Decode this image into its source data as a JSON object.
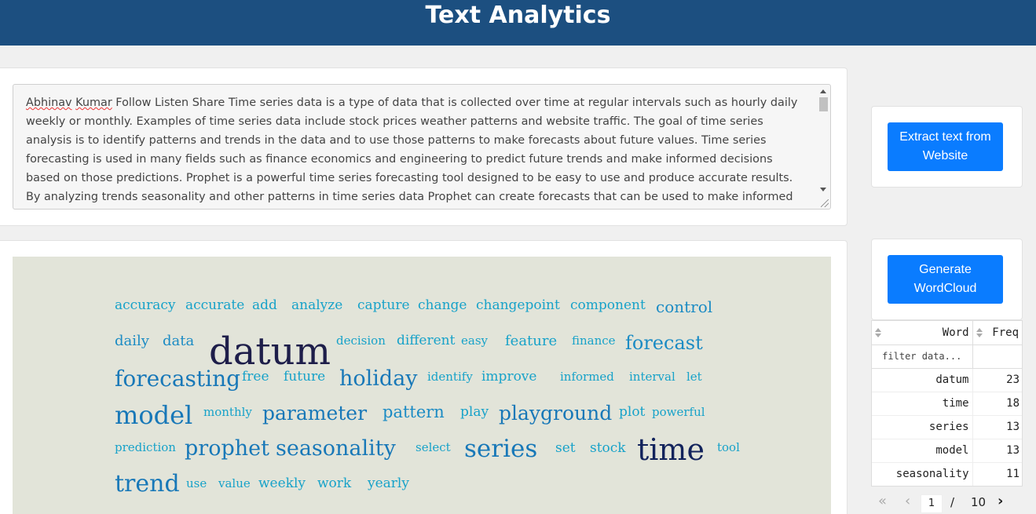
{
  "header": {
    "title": "Text Analytics"
  },
  "text_input": {
    "author_first": "Abhinav",
    "author_last": "Kumar",
    "value": " Follow    Listen Share Time series data is a type of data that is collected over time at regular intervals  such as hourly  daily  weekly  or monthly. Examples of time series data include stock prices  weather patterns  and website traffic. The goal of time series analysis is to identify patterns and trends in the data and to use those patterns to make forecasts about future values. Time series forecasting is used in many fields  such as finance  economics  and engineering  to predict future trends and make informed decisions based on those predictions. Prophet is a powerful time series forecasting tool designed to be easy to use and produce accurate results. By analyzing trends  seasonality  and other patterns in time series data  Prophet can create forecasts that can be used to make informed decisions and anticipate future"
  },
  "buttons": {
    "extract_label": "Extract text from Website",
    "wordcloud_label": "Generate WordCloud"
  },
  "wordcloud": {
    "background": "#e2e4d9",
    "words": [
      {
        "text": "accuracy",
        "color": "#17a2c9"
      },
      {
        "text": "accurate",
        "color": "#17a2c9"
      },
      {
        "text": "add",
        "color": "#17a2c9"
      },
      {
        "text": "analyze",
        "color": "#17a2c9"
      },
      {
        "text": "capture",
        "color": "#17a2c9"
      },
      {
        "text": "change",
        "color": "#17a2c9"
      },
      {
        "text": "changepoint",
        "color": "#17a2c9"
      },
      {
        "text": "component",
        "color": "#17a2c9"
      },
      {
        "text": "control",
        "color": "#1b8bc4"
      },
      {
        "text": "daily",
        "color": "#1b8bc4"
      },
      {
        "text": "data",
        "color": "#1b8bc4"
      },
      {
        "text": "datum",
        "color": "#1e1e4a"
      },
      {
        "text": "decision",
        "color": "#17a2c9"
      },
      {
        "text": "different",
        "color": "#17a2c9"
      },
      {
        "text": "easy",
        "color": "#17a2c9"
      },
      {
        "text": "feature",
        "color": "#17a2c9"
      },
      {
        "text": "finance",
        "color": "#17a2c9"
      },
      {
        "text": "forecast",
        "color": "#1b8bc4"
      },
      {
        "text": "forecasting",
        "color": "#1878b8"
      },
      {
        "text": "free",
        "color": "#17a2c9"
      },
      {
        "text": "future",
        "color": "#17a2c9"
      },
      {
        "text": "holiday",
        "color": "#1878b8"
      },
      {
        "text": "identify",
        "color": "#17a2c9"
      },
      {
        "text": "improve",
        "color": "#17a2c9"
      },
      {
        "text": "informed",
        "color": "#17a2c9"
      },
      {
        "text": "interval",
        "color": "#17a2c9"
      },
      {
        "text": "let",
        "color": "#17a2c9"
      },
      {
        "text": "model",
        "color": "#1878b8"
      },
      {
        "text": "monthly",
        "color": "#17a2c9"
      },
      {
        "text": "parameter",
        "color": "#1878b8"
      },
      {
        "text": "pattern",
        "color": "#1b8bc4"
      },
      {
        "text": "play",
        "color": "#17a2c9"
      },
      {
        "text": "playground",
        "color": "#1878b8"
      },
      {
        "text": "plot",
        "color": "#17a2c9"
      },
      {
        "text": "powerful",
        "color": "#17a2c9"
      },
      {
        "text": "prediction",
        "color": "#17a2c9"
      },
      {
        "text": "prophet",
        "color": "#1878b8"
      },
      {
        "text": "seasonality",
        "color": "#1878b8"
      },
      {
        "text": "select",
        "color": "#17a2c9"
      },
      {
        "text": "series",
        "color": "#1878b8"
      },
      {
        "text": "set",
        "color": "#17a2c9"
      },
      {
        "text": "stock",
        "color": "#17a2c9"
      },
      {
        "text": "time",
        "color": "#12235c"
      },
      {
        "text": "tool",
        "color": "#17a2c9"
      },
      {
        "text": "trend",
        "color": "#1878b8"
      },
      {
        "text": "use",
        "color": "#17a2c9"
      },
      {
        "text": "value",
        "color": "#17a2c9"
      },
      {
        "text": "weekly",
        "color": "#17a2c9"
      },
      {
        "text": "work",
        "color": "#17a2c9"
      },
      {
        "text": "yearly",
        "color": "#17a2c9"
      }
    ]
  },
  "freq_table": {
    "col_word": "Word",
    "col_freq": "Freq",
    "filter_placeholder": "filter data...",
    "rows": [
      {
        "word": "datum",
        "freq": "23"
      },
      {
        "word": "time",
        "freq": "18"
      },
      {
        "word": "series",
        "freq": "13"
      },
      {
        "word": "model",
        "freq": "13"
      },
      {
        "word": "seasonality",
        "freq": "11"
      }
    ]
  },
  "pagination": {
    "first": "«",
    "prev": "‹",
    "current": "1",
    "sep": "/",
    "total": "10",
    "next": "›"
  }
}
